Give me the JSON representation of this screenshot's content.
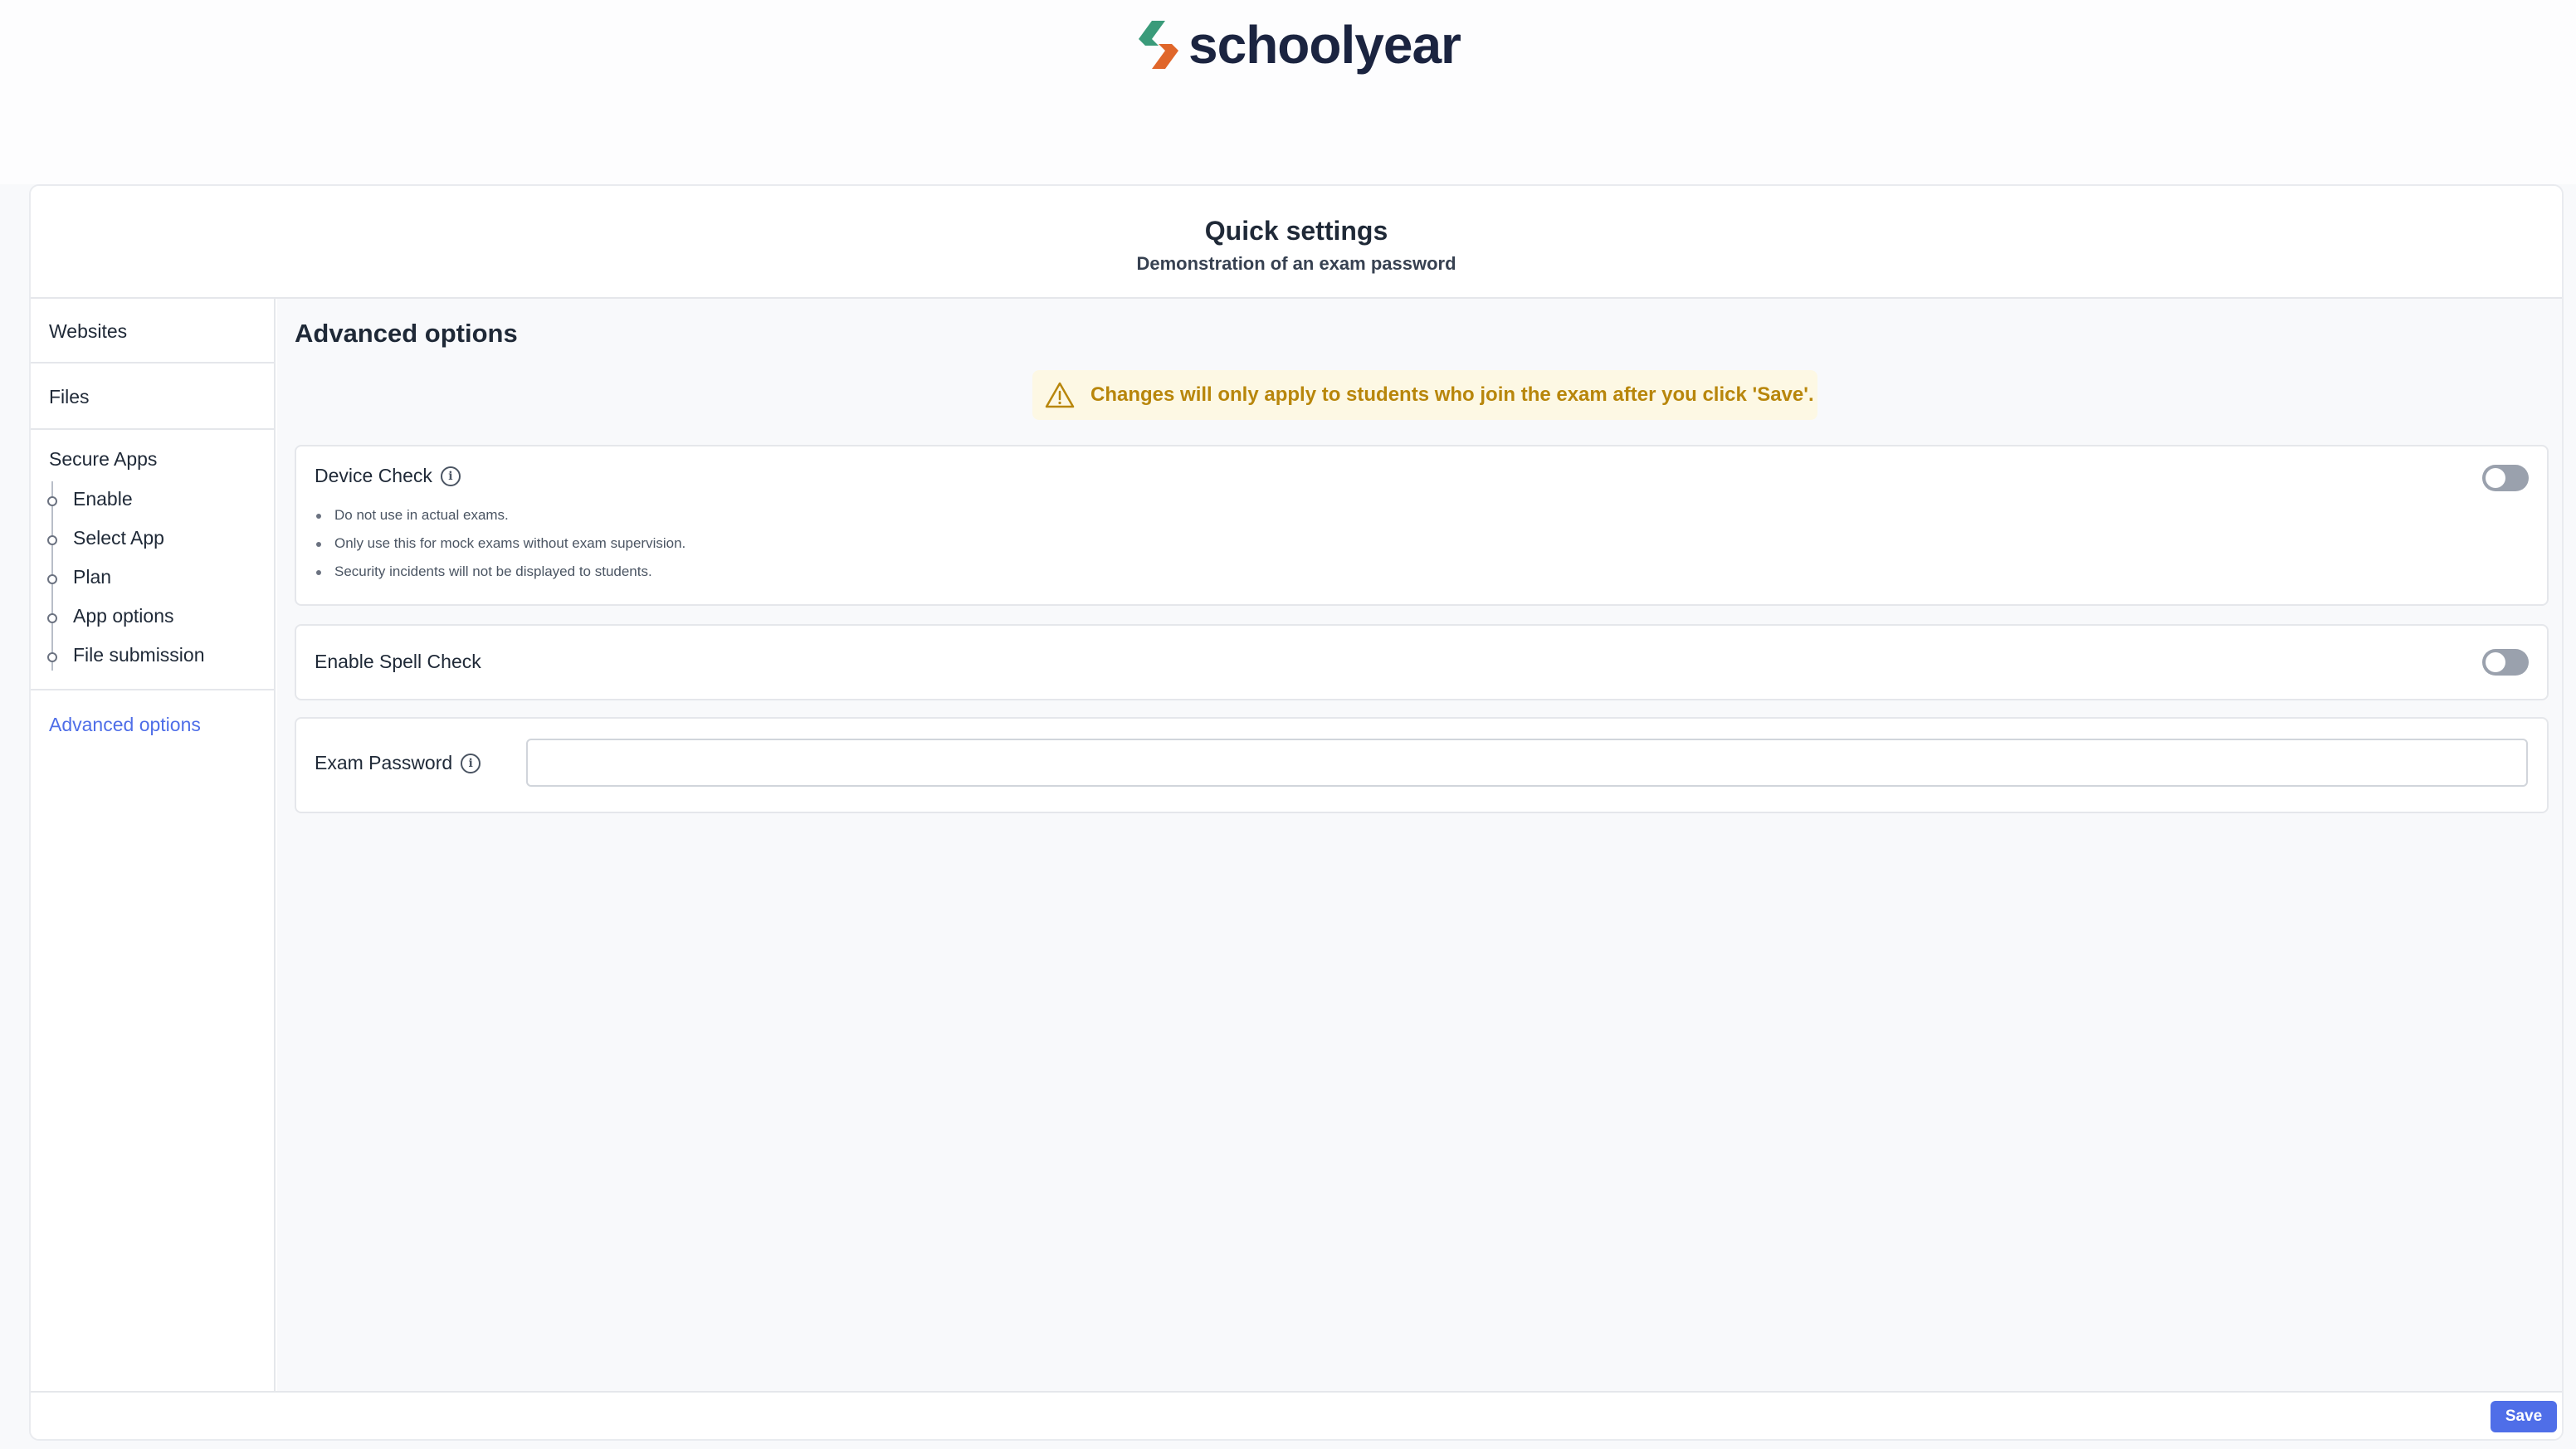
{
  "brand": {
    "name": "schoolyear"
  },
  "card": {
    "title": "Quick settings",
    "subtitle": "Demonstration of an exam password"
  },
  "sidebar": {
    "websites": "Websites",
    "files": "Files",
    "secure_apps": {
      "title": "Secure Apps",
      "items": [
        "Enable",
        "Select App",
        "Plan",
        "App options",
        "File submission"
      ]
    },
    "advanced": "Advanced options"
  },
  "main": {
    "title": "Advanced options",
    "notice": "Changes will only apply to students who join the exam after you click 'Save'.",
    "device_check": {
      "label": "Device Check",
      "enabled": false,
      "notes": [
        "Do not use in actual exams.",
        "Only use this for mock exams without exam supervision.",
        "Security incidents will not be displayed to students."
      ]
    },
    "spell_check": {
      "label": "Enable Spell Check",
      "enabled": false
    },
    "exam_password": {
      "label": "Exam Password",
      "value": "",
      "placeholder": ""
    }
  },
  "footer": {
    "save_label": "Save"
  },
  "colors": {
    "accent": "#4f6ee8",
    "warning_text": "#b8860b",
    "warning_bg": "#fdf8e4",
    "logo_green": "#3a9b7a",
    "logo_orange": "#e0662a"
  }
}
